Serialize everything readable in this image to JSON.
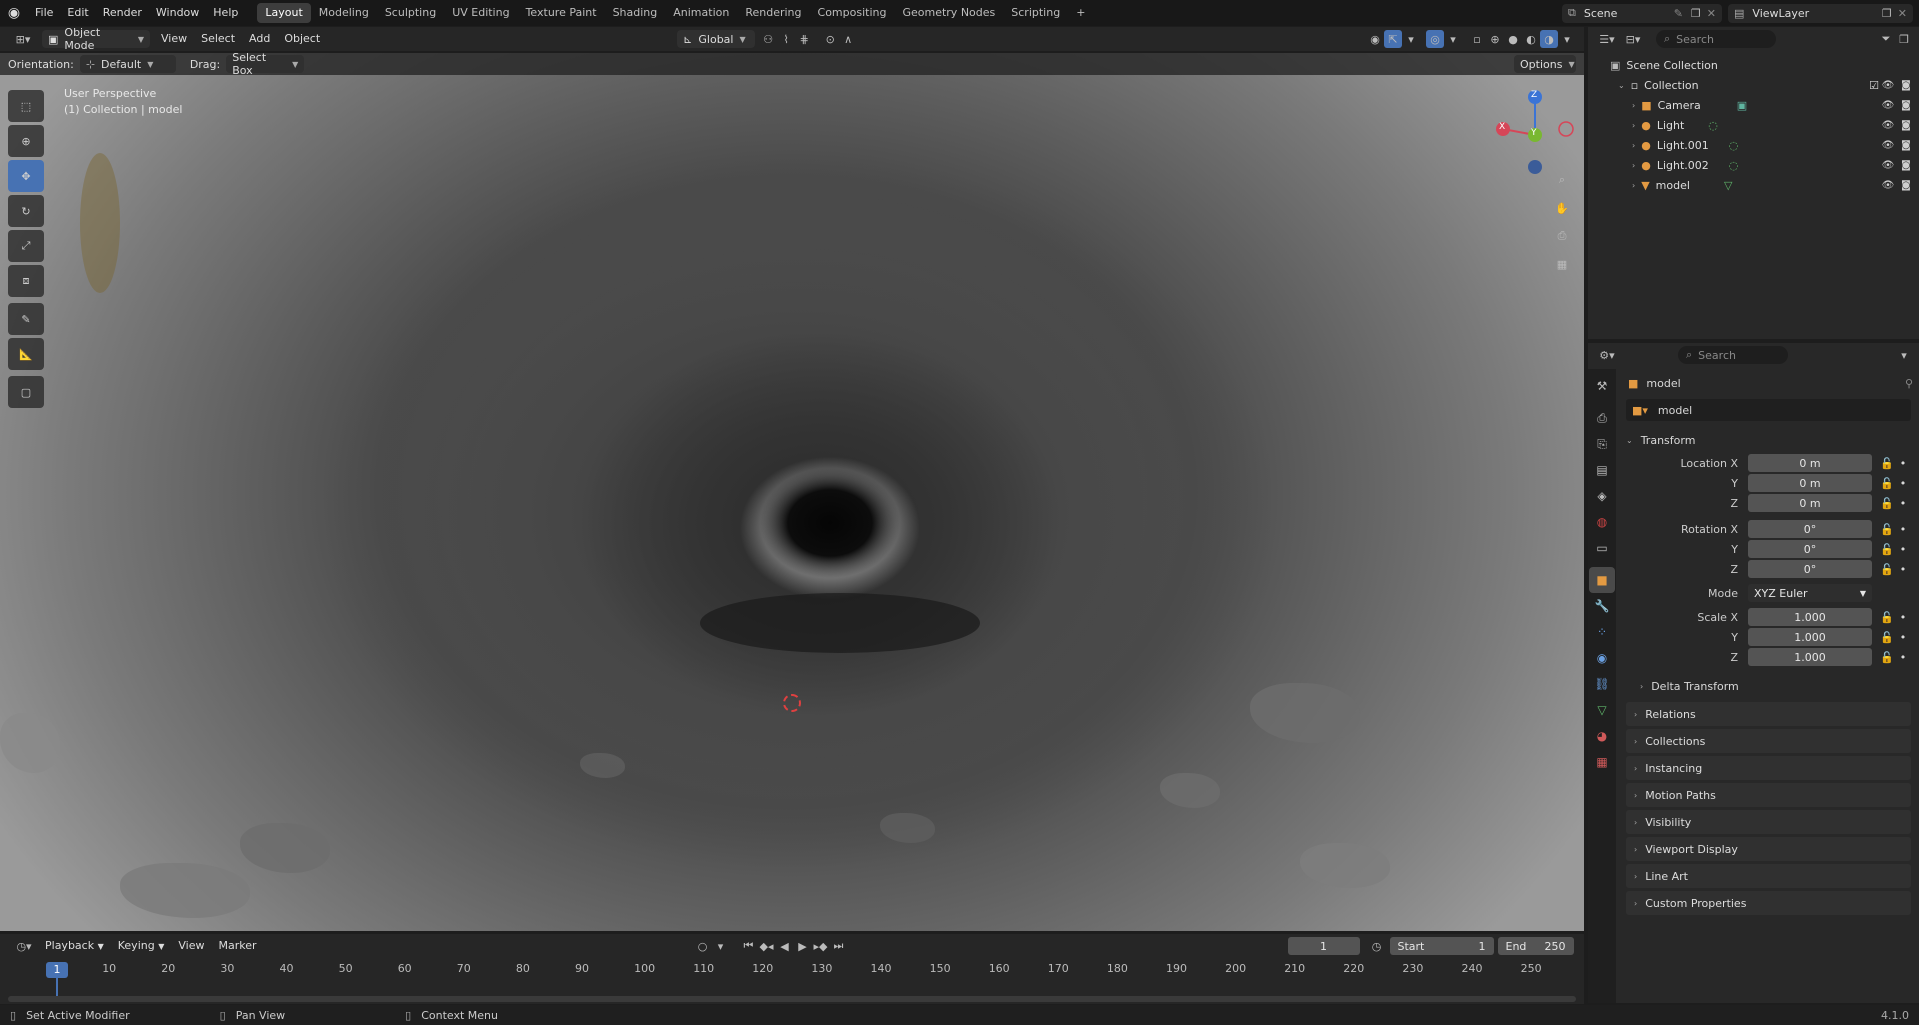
{
  "menu": [
    "File",
    "Edit",
    "Render",
    "Window",
    "Help"
  ],
  "workspaces": [
    "Layout",
    "Modeling",
    "Sculpting",
    "UV Editing",
    "Texture Paint",
    "Shading",
    "Animation",
    "Rendering",
    "Compositing",
    "Geometry Nodes",
    "Scripting"
  ],
  "active_workspace": "Layout",
  "scene_name": "Scene",
  "view_layer": "ViewLayer",
  "viewport_header": {
    "mode": "Object Mode",
    "menus": [
      "View",
      "Select",
      "Add",
      "Object"
    ],
    "transform_orientation": "Global",
    "orientation_label": "Orientation:",
    "orientation_value": "Default",
    "drag_label": "Drag:",
    "drag_value": "Select Box",
    "options": "Options"
  },
  "viewport_overlay": {
    "perspective": "User Perspective",
    "collection": "(1) Collection | model"
  },
  "gizmo": {
    "x": "X",
    "y": "Y",
    "z": "Z"
  },
  "outliner": {
    "search_placeholder": "Search",
    "scene_collection": "Scene Collection",
    "collection": "Collection",
    "items": [
      "Camera",
      "Light",
      "Light.001",
      "Light.002",
      "model"
    ]
  },
  "properties": {
    "search_placeholder": "Search",
    "object_name": "model",
    "datablock": "model",
    "transform": "Transform",
    "location_label": "Location X",
    "rotation_label": "Rotation X",
    "scale_label": "Scale X",
    "y": "Y",
    "z": "Z",
    "location": [
      "0 m",
      "0 m",
      "0 m"
    ],
    "rotation": [
      "0°",
      "0°",
      "0°"
    ],
    "mode_label": "Mode",
    "mode_value": "XYZ Euler",
    "scale": [
      "1.000",
      "1.000",
      "1.000"
    ],
    "delta_transform": "Delta Transform",
    "panels": [
      "Relations",
      "Collections",
      "Instancing",
      "Motion Paths",
      "Visibility",
      "Viewport Display",
      "Line Art",
      "Custom Properties"
    ]
  },
  "timeline": {
    "menus": [
      "Playback",
      "Keying",
      "View",
      "Marker"
    ],
    "current_frame": "1",
    "start_label": "Start",
    "start": "1",
    "end_label": "End",
    "end": "250",
    "ticks": [
      "1",
      "10",
      "20",
      "30",
      "40",
      "50",
      "60",
      "70",
      "80",
      "90",
      "100",
      "110",
      "120",
      "130",
      "140",
      "150",
      "160",
      "170",
      "180",
      "190",
      "200",
      "210",
      "220",
      "230",
      "240",
      "250"
    ]
  },
  "statusbar": {
    "left": "Set Active Modifier",
    "middle": "Pan View",
    "right": "Context Menu",
    "version": "4.1.0"
  },
  "colors": {
    "accent": "#4772b3",
    "selected_tab": "#3d3d3d"
  }
}
